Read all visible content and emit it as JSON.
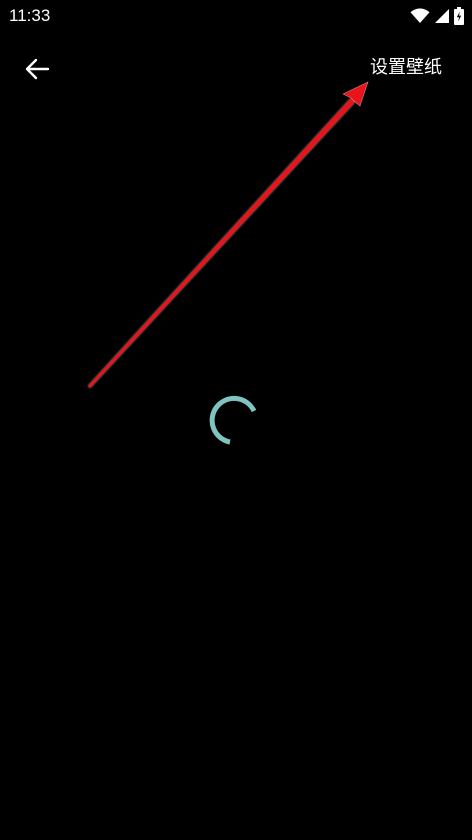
{
  "status_bar": {
    "time": "11:33",
    "icons": [
      "wifi-icon",
      "cellular-signal-icon",
      "battery-charging-icon"
    ]
  },
  "app_bar": {
    "back_icon": "arrow-left-icon",
    "action_label": "设置壁纸"
  },
  "content": {
    "state": "loading",
    "spinner_color": "#7fc4c0"
  },
  "annotation": {
    "arrow_color": "#e8141b"
  },
  "colors": {
    "background": "#000000",
    "foreground": "#ffffff"
  }
}
